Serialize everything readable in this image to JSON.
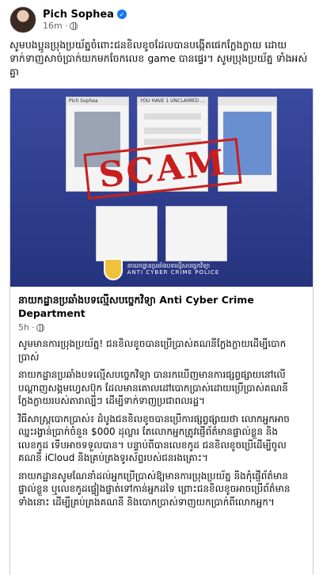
{
  "post": {
    "author": "Pich Sophea",
    "time": "16m",
    "separator": "·",
    "caption": "សូមបងប្អូនប្រុងប្រយ័ត្នចំពោះជនខិលខូចដែលបានបង្កើតផេកក្លែងក្លាយ ដោយទាក់ទាញសាច់ប្រាក់យកមកចែកលេខ game បានផ្ទេរ។ សូមប្រុងប្រយ័ត្ន ទាំងអស់គ្នា"
  },
  "media": {
    "stamp": "SCAM",
    "unit_kh": "នាយកដ្ឋានប្រឆាំងបទល្មើសបច្ចេកវិទ្យា",
    "unit_en": "ANTI CYBER CRIME POLICE",
    "screens": [
      {
        "title": "Pich Sophea"
      },
      {
        "title": "YOU HAVE 1 UNCLAIMED ..."
      },
      {
        "title": ""
      }
    ]
  },
  "shared": {
    "page_name": "នាយកដ្ឋានប្រឆាំងបទល្មើសបច្ចេកវិទ្យា Anti Cyber Crime Department",
    "time": "5h",
    "separator": "·",
    "paragraphs": [
      "សូមមានការប្រុងប្រយ័ត្ន! ជនខិលខូចបានប្រើប្រាស់គណនីក្លែងក្លាយដើម្បីបោកប្រាស់",
      "នាយកដ្ឋានប្រឆាំងបទល្មើសបច្ចេកវិទ្យា បានរកឃើញមានការផ្សព្វផ្សាយនៅលើបណ្ដាញសង្គមហ្វេសប៊ុក ដែលមានគោលដៅបោកប្រាស់ដោយប្រើប្រាស់គណនីក្លែងក្លាយរបស់តារាល្បីៗ ដើម្បីទាក់ទាញប្រជាពលរដ្ឋ។",
      "វិធីសាស្ត្របោកប្រាស់៖ ដំបូងជនខិលខូចបានប្រើការផ្សព្វផ្សាយថា លោកអ្នកអាចឈ្នះរង្វាន់ប្រាក់ចំនួន $000 ដុល្លារ តែលោកអ្នកត្រូវផ្ញើព័ត៌មានផ្ទាល់ខ្លួន និងលេខកូដ ទើបអាចទទួលបាន។ បន្ទាប់ពីបានលេខកូដ ជនខិលខូចប្រើដើម្បីចូលគណនី iCloud និងគ្រប់គ្រងទូរស័ព្ទរបស់ជនរងគ្រោះ។",
      "នាយកដ្ឋានសូមណែនាំដល់អ្នកប្រើប្រាស់ឱ្យមានការប្រុងប្រយ័ត្ន និងកុំផ្ញើព័ត៌មានផ្ទាល់ខ្លួន ឬលេខកូដផ្ទៀងផ្ទាត់ទៅកាន់អ្នកដទៃ ព្រោះជនខិលខូចអាចប្រើព័ត៌មានទាំងនោះ ដើម្បីគ្រប់គ្រងគណនី និងបោកប្រាស់ទាញយកប្រាក់ពីលោកអ្នក។"
    ]
  }
}
